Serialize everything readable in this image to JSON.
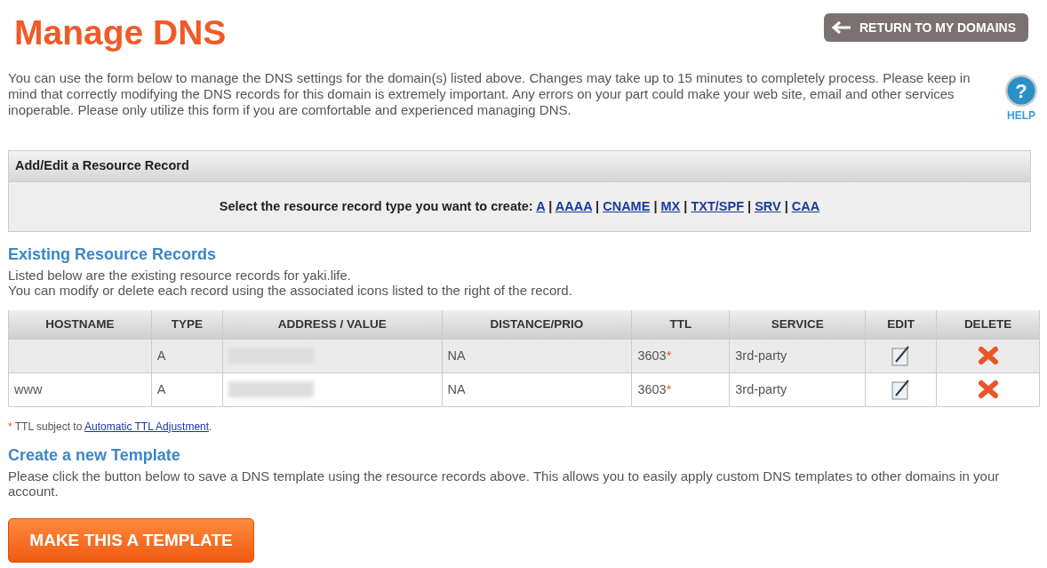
{
  "title": "Manage DNS",
  "return_button": {
    "label": "RETURN TO MY DOMAINS"
  },
  "intro": "You can use the form below to manage the DNS settings for the domain(s) listed above. Changes may take up to 15 minutes to completely process. Please keep in mind that correctly modifying the DNS records for this domain is extremely important. Any errors on your part could make your web site, email and other services inoperable. Please only utilize this form if you are comfortable and experienced managing DNS.",
  "help": {
    "glyph": "?",
    "label": "HELP"
  },
  "add_edit_panel": {
    "title": "Add/Edit a Resource Record",
    "prompt": "Select the resource record type you want to create:",
    "separator": "|",
    "types": [
      "A",
      "AAAA",
      "CNAME",
      "MX",
      "TXT/SPF",
      "SRV",
      "CAA"
    ]
  },
  "existing": {
    "heading": "Existing Resource Records",
    "lines": [
      "Listed below are the existing resource records for yaki.life.",
      "You can modify or delete each record using the associated icons listed to the right of the record."
    ]
  },
  "table": {
    "columns": [
      "HOSTNAME",
      "TYPE",
      "ADDRESS / VALUE",
      "DISTANCE/PRIO",
      "TTL",
      "SERVICE",
      "EDIT",
      "DELETE"
    ],
    "rows": [
      {
        "hostname": "",
        "type": "A",
        "distance": "NA",
        "ttl": "3603",
        "ttl_mark": "*",
        "service": "3rd-party"
      },
      {
        "hostname": "www",
        "type": "A",
        "distance": "NA",
        "ttl": "3603",
        "ttl_mark": "*",
        "service": "3rd-party"
      }
    ]
  },
  "footnote": {
    "mark": "*",
    "text": "TTL subject to",
    "link": "Automatic TTL Adjustment",
    "end": "."
  },
  "template": {
    "heading": "Create a new Template",
    "text": "Please click the button below to save a DNS template using the resource records above. This allows you to easily apply custom DNS templates to other domains in your account.",
    "button": "MAKE THIS A TEMPLATE"
  }
}
